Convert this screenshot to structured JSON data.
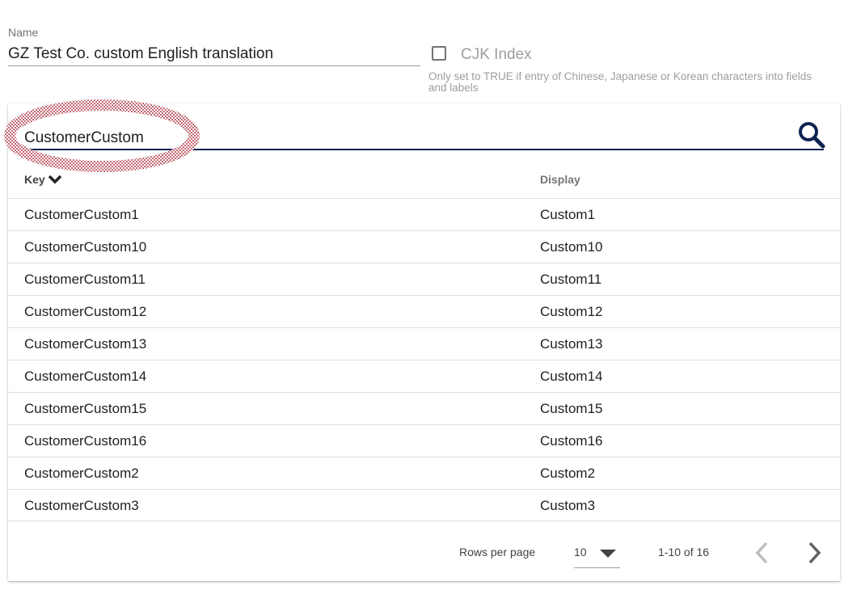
{
  "form": {
    "name_label": "Name",
    "name_value": "GZ Test Co. custom English translation",
    "cjk_label": "CJK Index",
    "cjk_checked": false,
    "cjk_hint": "Only set to TRUE if entry of Chinese, Japanese or Korean characters into fields and labels"
  },
  "search": {
    "value": "CustomerCustom"
  },
  "table": {
    "columns": {
      "key": "Key",
      "display": "Display"
    },
    "rows": [
      {
        "key": "CustomerCustom1",
        "display": "Custom1"
      },
      {
        "key": "CustomerCustom10",
        "display": "Custom10"
      },
      {
        "key": "CustomerCustom11",
        "display": "Custom11"
      },
      {
        "key": "CustomerCustom12",
        "display": "Custom12"
      },
      {
        "key": "CustomerCustom13",
        "display": "Custom13"
      },
      {
        "key": "CustomerCustom14",
        "display": "Custom14"
      },
      {
        "key": "CustomerCustom15",
        "display": "Custom15"
      },
      {
        "key": "CustomerCustom16",
        "display": "Custom16"
      },
      {
        "key": "CustomerCustom2",
        "display": "Custom2"
      },
      {
        "key": "CustomerCustom3",
        "display": "Custom3"
      }
    ]
  },
  "pagination": {
    "rows_per_page_label": "Rows per page",
    "rows_per_page_value": "10",
    "range": "1-10 of 16"
  },
  "icons": {
    "search": "search-icon",
    "sort": "chevron-down-icon",
    "caret": "caret-down-icon",
    "prev": "chevron-left-icon",
    "next": "chevron-right-icon"
  },
  "colors": {
    "accent": "#0f2452",
    "highlight": "#b03a48"
  }
}
